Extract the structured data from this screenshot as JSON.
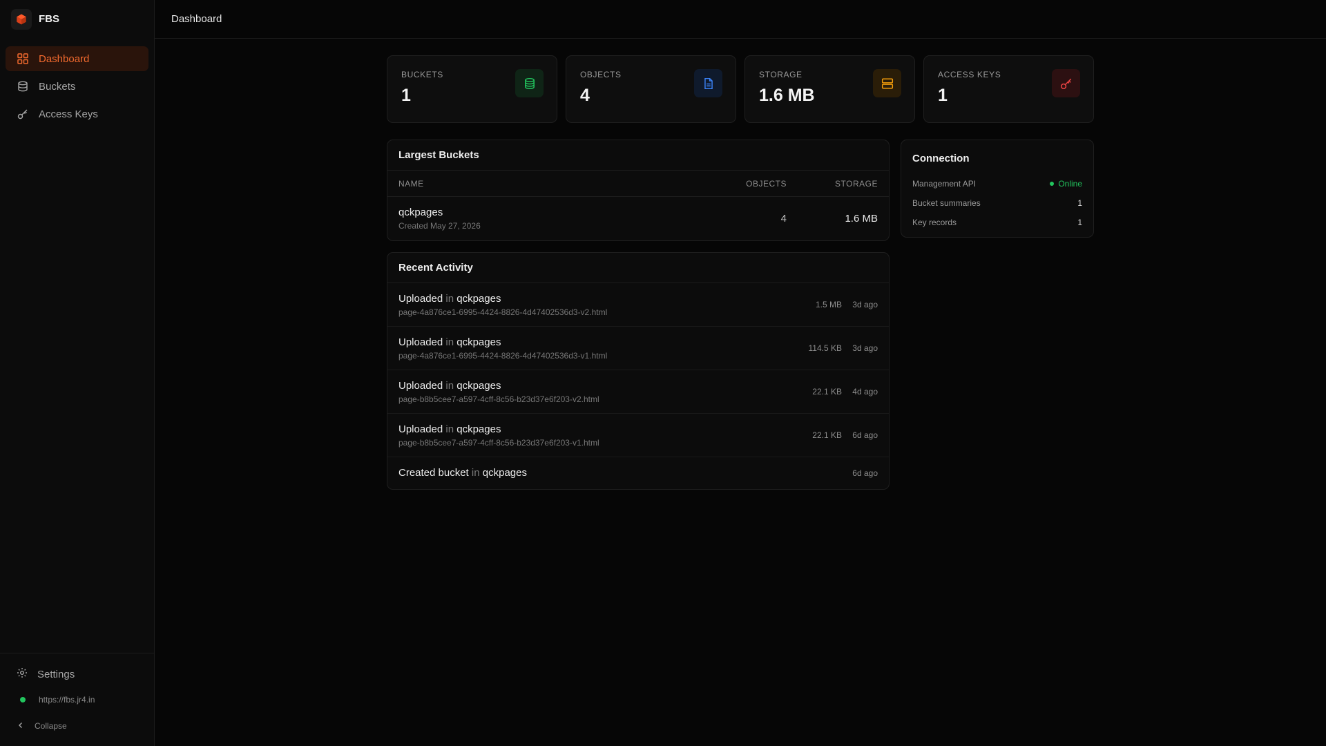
{
  "app": {
    "name": "FBS"
  },
  "sidebar": {
    "items": [
      {
        "label": "Dashboard",
        "icon": "grid-icon",
        "active": true
      },
      {
        "label": "Buckets",
        "icon": "database-icon",
        "active": false
      },
      {
        "label": "Access Keys",
        "icon": "key-icon",
        "active": false
      }
    ],
    "footer": {
      "settings_label": "Settings",
      "url": "https://fbs.jr4.in",
      "collapse_label": "Collapse"
    }
  },
  "header": {
    "title": "Dashboard"
  },
  "stats": [
    {
      "label": "BUCKETS",
      "value": "1",
      "icon": "database-icon",
      "color": "#22c55e"
    },
    {
      "label": "OBJECTS",
      "value": "4",
      "icon": "file-icon",
      "color": "#3b82f6"
    },
    {
      "label": "STORAGE",
      "value": "1.6 MB",
      "icon": "server-icon",
      "color": "#f59e0b"
    },
    {
      "label": "ACCESS KEYS",
      "value": "1",
      "icon": "key-icon",
      "color": "#ef4444"
    }
  ],
  "largest_buckets": {
    "title": "Largest Buckets",
    "columns": [
      "NAME",
      "OBJECTS",
      "STORAGE"
    ],
    "rows": [
      {
        "name": "qckpages",
        "created": "Created May 27, 2026",
        "objects": "4",
        "storage": "1.6 MB"
      }
    ]
  },
  "recent_activity": {
    "title": "Recent Activity",
    "items": [
      {
        "action": "Uploaded",
        "in": "in",
        "bucket": "qckpages",
        "file": "page-4a876ce1-6995-4424-8826-4d47402536d3-v2.html",
        "size": "1.5 MB",
        "time": "3d ago"
      },
      {
        "action": "Uploaded",
        "in": "in",
        "bucket": "qckpages",
        "file": "page-4a876ce1-6995-4424-8826-4d47402536d3-v1.html",
        "size": "114.5 KB",
        "time": "3d ago"
      },
      {
        "action": "Uploaded",
        "in": "in",
        "bucket": "qckpages",
        "file": "page-b8b5cee7-a597-4cff-8c56-b23d37e6f203-v2.html",
        "size": "22.1 KB",
        "time": "4d ago"
      },
      {
        "action": "Uploaded",
        "in": "in",
        "bucket": "qckpages",
        "file": "page-b8b5cee7-a597-4cff-8c56-b23d37e6f203-v1.html",
        "size": "22.1 KB",
        "time": "6d ago"
      },
      {
        "action": "Created bucket",
        "in": "in",
        "bucket": "qckpages",
        "time": "6d ago"
      }
    ]
  },
  "connection": {
    "title": "Connection",
    "rows": [
      {
        "label": "Management API",
        "value": "Online"
      },
      {
        "label": "Bucket summaries",
        "value": "1"
      },
      {
        "label": "Key records",
        "value": "1"
      }
    ],
    "status_color": "#22c55e"
  },
  "colors": {
    "accent": "#f26a2e",
    "background": "#060606"
  }
}
